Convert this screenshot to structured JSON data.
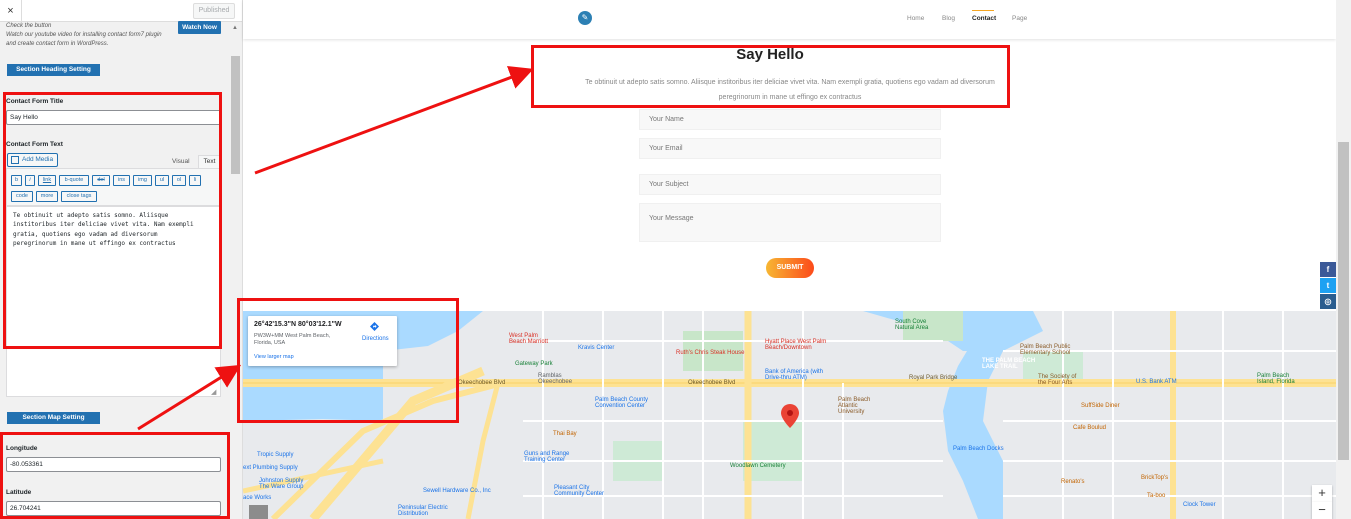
{
  "panel": {
    "close_label": "×",
    "published_label": "Published",
    "hint_text": "Check the button\nWatch our youtube video for installing contact form7 plugin\nand create contact form in WordPress.",
    "watch_now_label": "Watch Now",
    "heading_section_label": "Section Heading Setting",
    "contact_form_title_label": "Contact Form Title",
    "contact_form_title_value": "Say Hello",
    "contact_form_text_label": "Contact Form Text",
    "add_media_label": "Add Media",
    "tab_visual": "Visual",
    "tab_text": "Text",
    "quicktags": [
      "b",
      "i",
      "link",
      "b-quote",
      "del",
      "ins",
      "img",
      "ul",
      "ol",
      "li",
      "code",
      "more",
      "close tags"
    ],
    "editor_text": "Te obtinuit ut adepto satis somno. Aliisque\ninstitoribus iter deliciae vivet vita. Nam exempli\ngratia, quotiens ego vadam ad diversorum\nperegrinorum in mane ut effingo ex contractus",
    "map_section_label": "Section Map Setting",
    "longitude_label": "Longitude",
    "longitude_value": "-80.053361",
    "latitude_label": "Latitude",
    "latitude_value": "26.704241"
  },
  "site": {
    "nav": [
      "Home",
      "Blog",
      "Contact",
      "Page"
    ],
    "active_nav": "Contact",
    "heading": "Say Hello",
    "subtext": "Te obtinuit ut adepto satis somno. Aliisque institoribus iter deliciae vivet vita. Nam exempli gratia, quotiens ego vadam ad diversorum peregrinorum in mane ut effingo ex contractus",
    "placeholders": {
      "name": "Your Name",
      "email": "Your Email",
      "subject": "Your Subject",
      "message": "Your Message"
    },
    "submit_label": "SUBMIT",
    "social": [
      {
        "name": "facebook-icon",
        "glyph": "f",
        "color": "#3b5998"
      },
      {
        "name": "twitter-icon",
        "glyph": "t",
        "color": "#1da1f2"
      },
      {
        "name": "instagram-icon",
        "glyph": "◎",
        "color": "#2a5d8f"
      },
      {
        "name": "pinterest-icon",
        "glyph": "p",
        "color": "#cb2027"
      }
    ]
  },
  "map": {
    "coords": "26°42'15.3\"N 80°03'12.1\"W",
    "address": "PW3W+MM West Palm Beach, Florida, USA",
    "directions_label": "Directions",
    "larger_map_label": "View larger map",
    "zoom_in": "+",
    "zoom_out": "−",
    "labels": {
      "west_palm_marriott": "West Palm\nBeach Marriott",
      "kravis": "Kravis Center",
      "ruths": "Ruth's Chris Steak House",
      "hyatt": "Hyatt Place West Palm\nBeach/Downtown",
      "south_cove": "South Cove\nNatural Area",
      "breakers": "THE PALM BEACH\nLAKE TRAIL",
      "palm_beach_public": "Palm Beach Public\nElementary School",
      "gateway": "Gateway Park",
      "ramblas": "Ramblas\nOkeechobee",
      "bank_america": "Bank of America (with\nDrive-thru ATM)",
      "royal_park": "Royal Park Bridge",
      "society": "The Society of\nthe Four Arts",
      "us_bank": "U.S. Bank ATM",
      "palm_beach_island": "Palm Beach\nIsland, Florida",
      "okeechobee_blvd_1": "Okeechobee Blvd",
      "okeechobee_blvd_2": "Okeechobee Blvd",
      "convention": "Palm Beach County\nConvention Center",
      "atlantic": "Palm Beach\nAtlantic\nUniversity",
      "suffside": "SuffSide Diner",
      "thai": "Thai Bay",
      "cafe_boulud": "Cafe Boulud",
      "guns_range": "Guns and Range\nTraining Center",
      "woodlawn": "Woodlawn Cemetery",
      "palm_beach_docks": "Palm Beach Docks",
      "tropic": "Tropic Supply",
      "plumbing": "ext Plumbing Supply",
      "johnston": "Johnston Supply\nThe Ware Group",
      "sewell": "Sewell Hardware Co., Inc",
      "pleasant_city": "Pleasant City\nCommunity Center",
      "peninsular": "Peninsular Electric\nDistribution",
      "renatos": "Renato's",
      "brick_top": "BrickTop's",
      "taboo": "Ta-boo",
      "clock_tower": "Clock Tower",
      "ace_works": "ace Works",
      "s_olive": "S Olive Ave",
      "s_dixie": "S Dixie Hwy",
      "s_australian": "S Australian Ave",
      "s_county": "S County Rd"
    }
  },
  "annotation_color": "#ee1111",
  "brand_blue": "#2271b1"
}
